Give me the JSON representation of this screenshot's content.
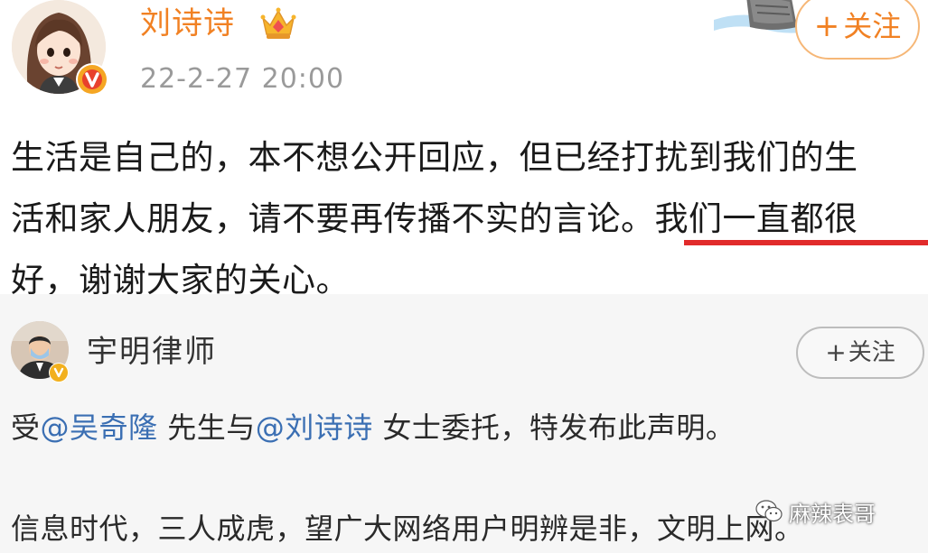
{
  "post1": {
    "username": "刘诗诗",
    "timestamp": "22-2-27 20:00",
    "follow_plus": "+",
    "follow_label": "关注",
    "lines": [
      "生活是自己的，本不想公开回应，但已经打扰到我们的生",
      "活和家人朋友，请不要再传播不实的言论。我们一直都很",
      "好，谢谢大家的关心。"
    ],
    "underline_color": "#e12b2b",
    "username_color": "#f18123",
    "avatar_icon": "cartoon-girl-avatar",
    "badge_icon": "verified-v-icon",
    "crown_icon": "crown-icon"
  },
  "post2": {
    "username": "宇明律师",
    "follow_plus": "+",
    "follow_label": "关注",
    "line1": {
      "prefix": "受",
      "mention1": "@吴奇隆",
      "middle": " 先生与",
      "mention2": "@刘诗诗",
      "suffix": " 女士委托，特发布此声明。"
    },
    "line2": "信息时代，三人成虎，望广大网络用户明辨是非，文明上网。",
    "mention_color": "#3b6fb3",
    "avatar_icon": "person-with-mask-avatar",
    "badge_icon": "verified-v-icon"
  },
  "watermark": {
    "text": "麻辣表哥",
    "icon": "wechat-icon"
  }
}
